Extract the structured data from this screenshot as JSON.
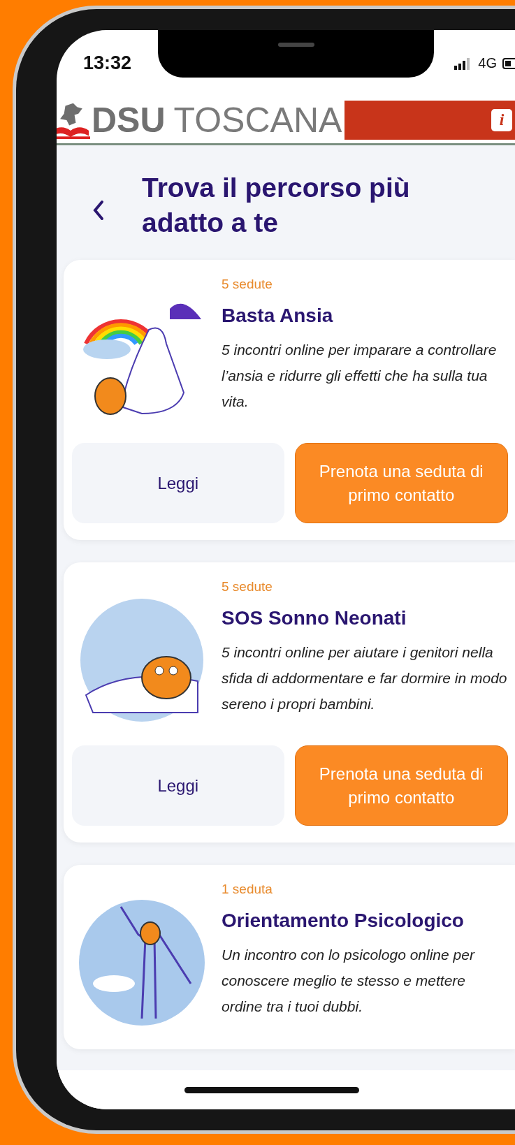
{
  "status_bar": {
    "time": "13:32",
    "network": "4G"
  },
  "header": {
    "logo_bold": "DSU",
    "logo_regular": "TOSCANA",
    "info_icon": "i"
  },
  "page": {
    "title": "Trova il percorso più adatto a te"
  },
  "courses": [
    {
      "sessions": "5 sedute",
      "title": "Basta Ansia",
      "description": "5 incontri online per imparare a controllare l’ansia e ridurre gli effetti che ha sulla tua vita.",
      "buttons": [
        {
          "kind": "read",
          "label": "Leggi"
        },
        {
          "kind": "book",
          "label": "Prenota una seduta di primo contatto"
        }
      ]
    },
    {
      "sessions": "5 sedute",
      "title": "SOS Sonno Neonati",
      "description": "5 incontri online per aiutare i genitori nella sfida di addormentare e far dormire in modo sereno i propri bambini.",
      "buttons": [
        {
          "kind": "read",
          "label": "Leggi"
        },
        {
          "kind": "book",
          "label": "Prenota una seduta di primo contatto"
        }
      ]
    },
    {
      "sessions": "1 seduta",
      "title": "Orientamento Psicologico",
      "description": "Un incontro con lo psicologo online per conoscere meglio te stesso e mettere ordine tra i tuoi dubbi."
    }
  ]
}
